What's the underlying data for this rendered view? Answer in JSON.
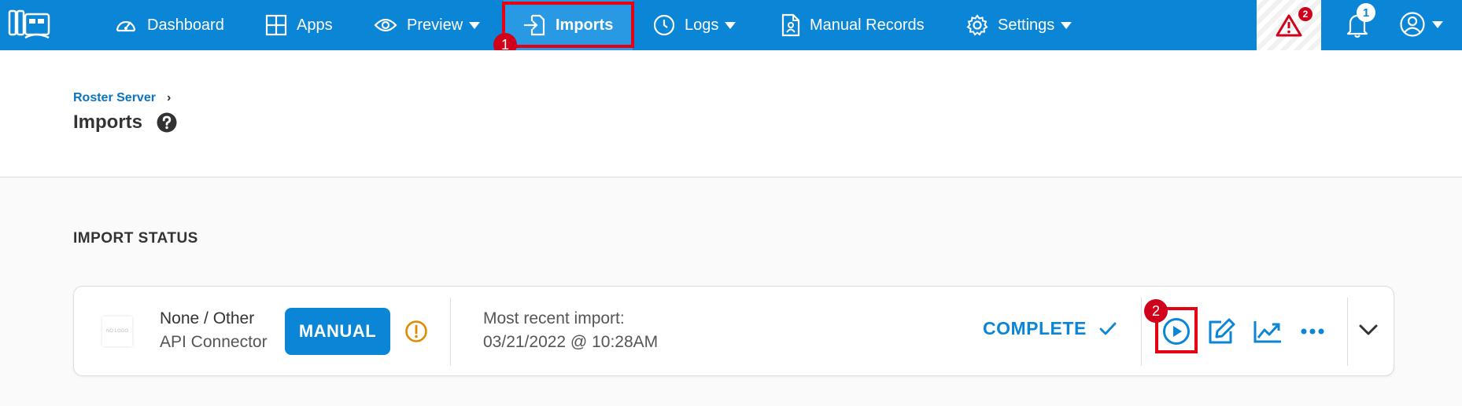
{
  "nav": {
    "items": [
      {
        "label": "Dashboard",
        "icon": "gauge-icon"
      },
      {
        "label": "Apps",
        "icon": "grid-icon"
      },
      {
        "label": "Preview",
        "icon": "eye-icon"
      },
      {
        "label": "Imports",
        "icon": "import-icon"
      },
      {
        "label": "Logs",
        "icon": "clock-icon"
      },
      {
        "label": "Manual Records",
        "icon": "document-user-icon"
      },
      {
        "label": "Settings",
        "icon": "gear-icon"
      }
    ],
    "active": "Imports",
    "alert_count": "2",
    "notification_count": "1"
  },
  "markers": [
    "1",
    "2"
  ],
  "breadcrumb": {
    "parent": "Roster Server",
    "separator": "›"
  },
  "page": {
    "title": "Imports"
  },
  "section": {
    "title": "IMPORT STATUS"
  },
  "import_card": {
    "logo_text": "NO LOGO",
    "name": "None / Other",
    "type": "API Connector",
    "mode": "MANUAL",
    "recent_label": "Most recent import:",
    "recent_date": "03/21/2022 @ 10:28AM",
    "status": "COMPLETE"
  },
  "colors": {
    "brand": "#0b85d6",
    "warning": "#e38b00",
    "alert": "#d0021b"
  }
}
